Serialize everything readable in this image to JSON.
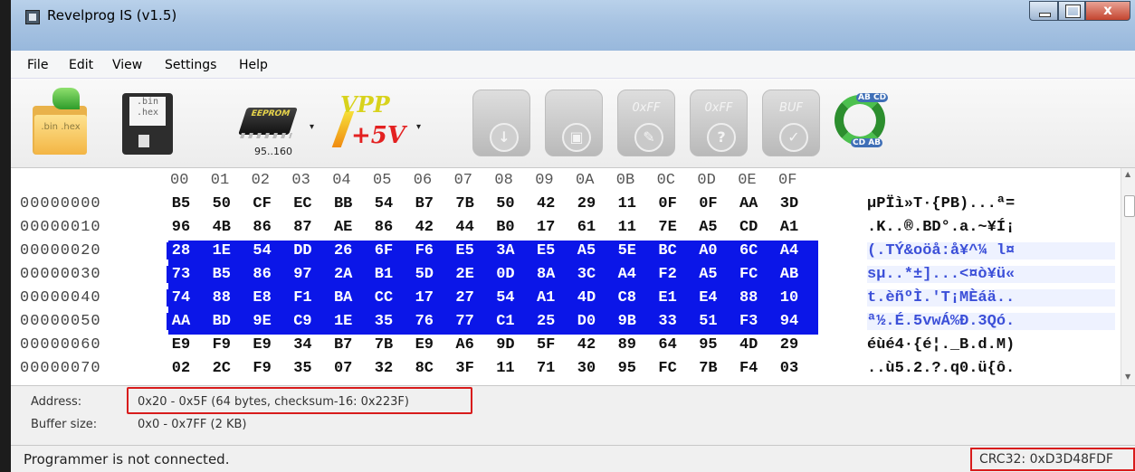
{
  "window": {
    "title": "Revelprog IS (v1.5)",
    "close_glyph": "x"
  },
  "menu": [
    "File",
    "Edit",
    "View",
    "Settings",
    "Help"
  ],
  "toolbar": {
    "open_label": ".bin .hex",
    "save_label": ".bin .hex",
    "chip_label": "EEPROM",
    "chip_caption": "95..160",
    "vpp_top": "VPP",
    "vpp_bottom": "+5V",
    "erase_label": "0xFF",
    "blank_label": "0xFF",
    "blank_badge": "?",
    "buf_label": "BUF",
    "swap_top": "AB CD",
    "swap_bottom": "CD AB",
    "dropdown_glyph": "▾",
    "accent_green": "#2e9c2a",
    "vpp_yellow": "#d8d21c",
    "vpp_red": "#e32121"
  },
  "hex": {
    "columns": [
      "00",
      "01",
      "02",
      "03",
      "04",
      "05",
      "06",
      "07",
      "08",
      "09",
      "0A",
      "0B",
      "0C",
      "0D",
      "0E",
      "0F"
    ],
    "selection_color": "#0b16e8",
    "rows": [
      {
        "addr": "00000000",
        "bytes": [
          "B5",
          "50",
          "CF",
          "EC",
          "BB",
          "54",
          "B7",
          "7B",
          "50",
          "42",
          "29",
          "11",
          "0F",
          "0F",
          "AA",
          "3D"
        ],
        "ascii": "µPÏì»T·{PB)...ª=",
        "selected": false
      },
      {
        "addr": "00000010",
        "bytes": [
          "96",
          "4B",
          "86",
          "87",
          "AE",
          "86",
          "42",
          "44",
          "B0",
          "17",
          "61",
          "11",
          "7E",
          "A5",
          "CD",
          "A1"
        ],
        "ascii": ".K..®.BD°.a.~¥Í¡",
        "selected": false
      },
      {
        "addr": "00000020",
        "bytes": [
          "28",
          "1E",
          "54",
          "DD",
          "26",
          "6F",
          "F6",
          "E5",
          "3A",
          "E5",
          "A5",
          "5E",
          "BC",
          "A0",
          "6C",
          "A4"
        ],
        "ascii": "(.TÝ&oöå:å¥^¼ l¤",
        "selected": true
      },
      {
        "addr": "00000030",
        "bytes": [
          "73",
          "B5",
          "86",
          "97",
          "2A",
          "B1",
          "5D",
          "2E",
          "0D",
          "8A",
          "3C",
          "A4",
          "F2",
          "A5",
          "FC",
          "AB"
        ],
        "ascii": "sµ..*±]...<¤ò¥ü«",
        "selected": true
      },
      {
        "addr": "00000040",
        "bytes": [
          "74",
          "88",
          "E8",
          "F1",
          "BA",
          "CC",
          "17",
          "27",
          "54",
          "A1",
          "4D",
          "C8",
          "E1",
          "E4",
          "88",
          "10"
        ],
        "ascii": "t.èñºÌ.'T¡MÈáä..",
        "selected": true
      },
      {
        "addr": "00000050",
        "bytes": [
          "AA",
          "BD",
          "9E",
          "C9",
          "1E",
          "35",
          "76",
          "77",
          "C1",
          "25",
          "D0",
          "9B",
          "33",
          "51",
          "F3",
          "94"
        ],
        "ascii": "ª½.É.5vwÁ%Ð.3Qó.",
        "selected": true
      },
      {
        "addr": "00000060",
        "bytes": [
          "E9",
          "F9",
          "E9",
          "34",
          "B7",
          "7B",
          "E9",
          "A6",
          "9D",
          "5F",
          "42",
          "89",
          "64",
          "95",
          "4D",
          "29"
        ],
        "ascii": "éùé4·{é¦._B.d.M)",
        "selected": false
      },
      {
        "addr": "00000070",
        "bytes": [
          "02",
          "2C",
          "F9",
          "35",
          "07",
          "32",
          "8C",
          "3F",
          "11",
          "71",
          "30",
          "95",
          "FC",
          "7B",
          "F4",
          "03"
        ],
        "ascii": "..ù5.2.?.q0.ü{ô.",
        "selected": false
      }
    ]
  },
  "info": {
    "address_label": "Address:",
    "address_value": "0x20 - 0x5F (64 bytes, checksum-16: 0x223F)",
    "buffer_label": "Buffer size:",
    "buffer_value": "0x0 - 0x7FF (2 KB)"
  },
  "status": {
    "message": "Programmer is not connected.",
    "crc": "CRC32: 0xD3D48FDF",
    "highlight_color": "#d81c1c"
  }
}
